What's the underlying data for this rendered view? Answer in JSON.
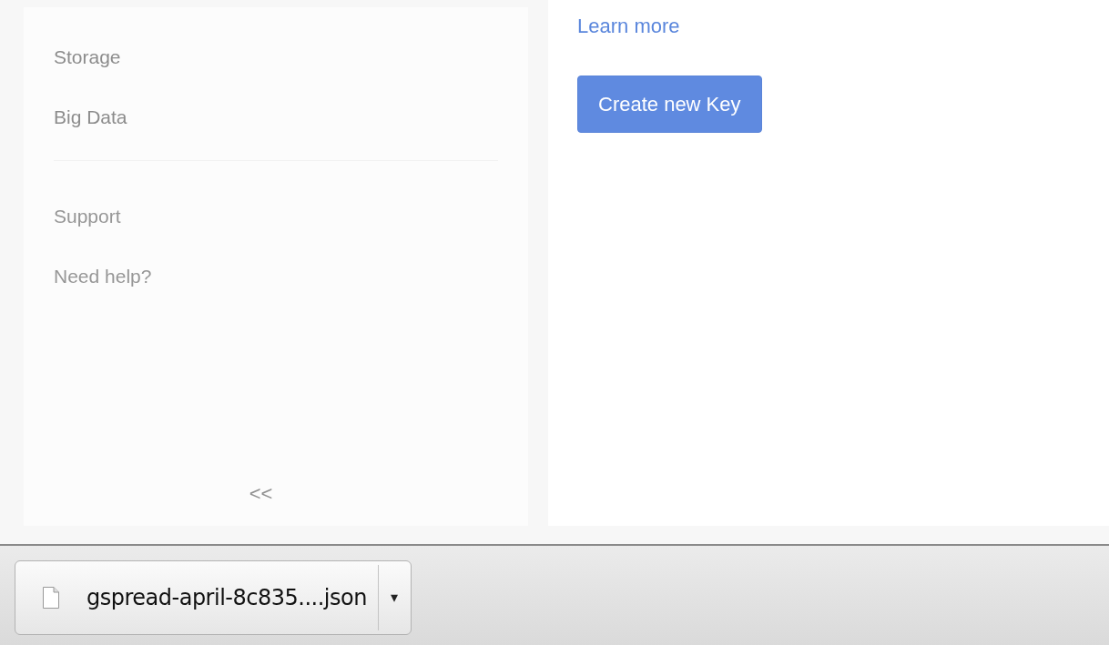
{
  "sidebar": {
    "items": [
      {
        "label": "Storage"
      },
      {
        "label": "Big Data"
      }
    ],
    "support_items": [
      {
        "label": "Support"
      },
      {
        "label": "Need help?"
      }
    ],
    "collapse_label": "<<"
  },
  "main": {
    "link": "Learn more",
    "button": "Create new Key"
  },
  "download_bar": {
    "file_name": "gspread-april-8c835....json",
    "menu_caret": "▾"
  }
}
